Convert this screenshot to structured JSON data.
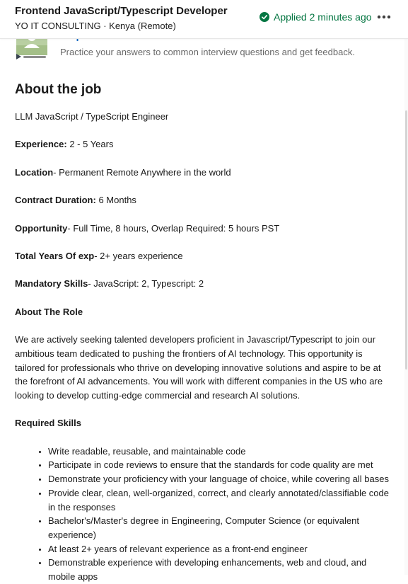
{
  "header": {
    "job_title": "Frontend JavaScript/Typescript Developer",
    "company_location": "YO IT CONSULTING · Kenya (Remote)",
    "applied_status": "Applied 2 minutes ago",
    "more_label": "•••",
    "status_color": "#057642"
  },
  "prep": {
    "link_text": "Prepare for interviews",
    "description": "Practice your answers to common interview questions and get feedback.",
    "link_color": "#0a66c2",
    "illustration_icon": "interview-prep-illustration-icon"
  },
  "about": {
    "heading": "About the job",
    "intro": "LLM JavaScript / TypeScript Engineer",
    "facts": [
      {
        "label": "Experience:",
        "value": " 2 - 5 Years"
      },
      {
        "label": "Location",
        "value": "- Permanent Remote Anywhere in the world"
      },
      {
        "label": "Contract Duration:",
        "value": " 6 Months"
      },
      {
        "label": "Opportunity",
        "value": "- Full Time, 8 hours, Overlap Required: 5 hours PST"
      },
      {
        "label": "Total Years Of exp",
        "value": "- 2+ years experience"
      },
      {
        "label": "Mandatory Skills",
        "value": "- JavaScript: 2, Typescript: 2"
      }
    ],
    "role_heading": "About The Role",
    "role_text": "We are actively seeking talented developers proficient in Javascript/Typescript to join our ambitious team dedicated to pushing the frontiers of AI technology. This opportunity is tailored for professionals who thrive on developing innovative solutions and aspire to be at the forefront of AI advancements. You will work with different companies in the US who are looking to develop cutting-edge commercial and research AI solutions.",
    "skills_heading": "Required Skills",
    "skills": [
      "Write readable, reusable, and maintainable code",
      "Participate in code reviews to ensure that the standards for code quality are met",
      "Demonstrate your proficiency with your language of choice, while covering all bases",
      "Provide clear, clean, well-organized, correct, and clearly annotated/classifiable code in the responses",
      "Bachelor's/Master's degree in Engineering, Computer Science (or equivalent experience)",
      "At least 2+ years of relevant experience as a front-end engineer",
      "Demonstrable experience with developing enhancements, web and cloud, and mobile apps"
    ]
  }
}
